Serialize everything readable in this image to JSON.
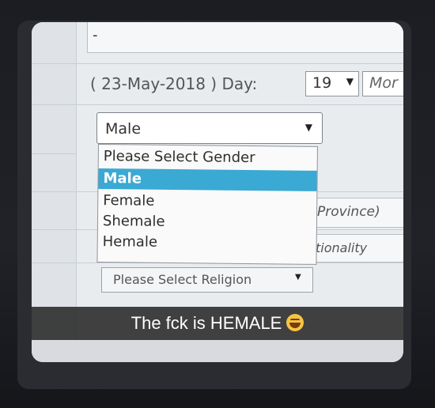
{
  "form": {
    "top_value": "-",
    "date_text": "( 23-May-2018 ) Day:",
    "day_value": "19",
    "month_partial": "Mor",
    "gender_value": "Male",
    "gender_options": [
      "Please Select Gender",
      "Male",
      "Female",
      "Shemale",
      "Hemale"
    ],
    "gender_selected_index": 1,
    "province_partial": "Province)",
    "nationality_partial": "tionality",
    "religion_placeholder": "Please Select Religion"
  },
  "caption": {
    "text": "The fck is HEMALE",
    "emoji": "laughing-sweat-emoji"
  },
  "colors": {
    "selected_option": "#3aa9d3",
    "caption_bg": "#282828"
  }
}
